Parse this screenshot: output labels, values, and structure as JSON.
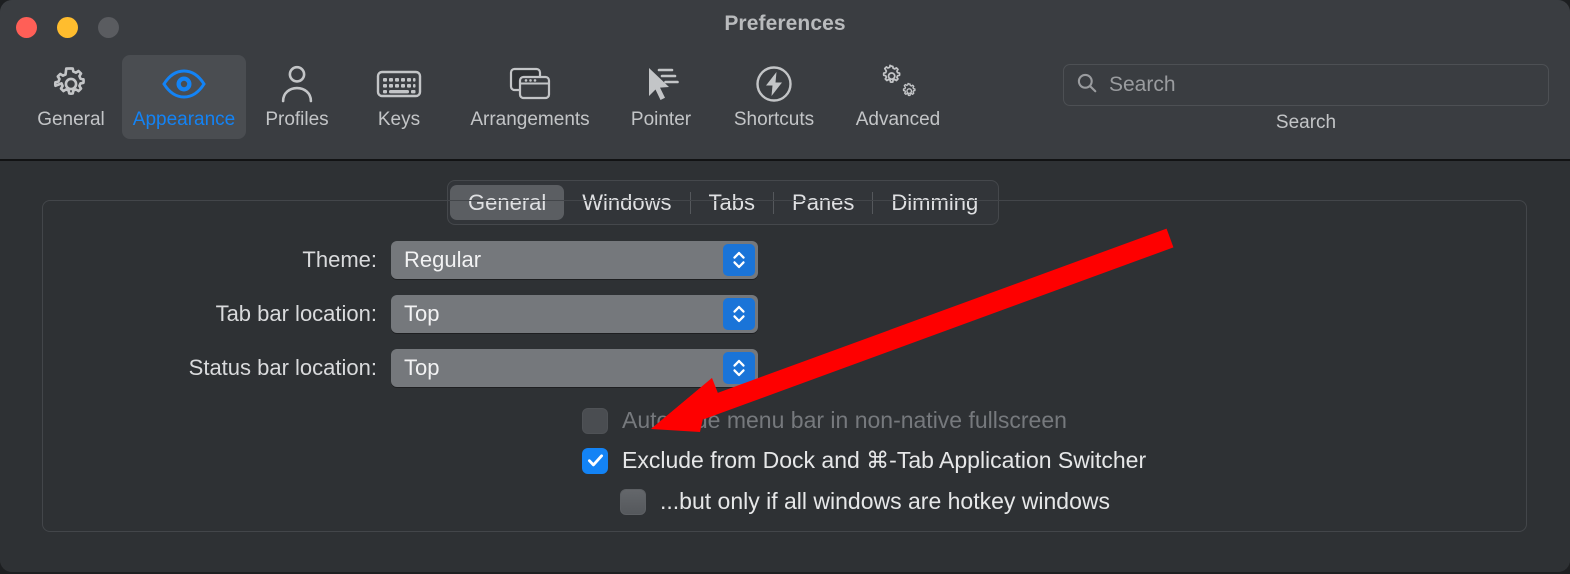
{
  "window": {
    "title": "Preferences",
    "traffic_lights": [
      {
        "name": "close-button",
        "color": "#ff5f57"
      },
      {
        "name": "minimize-button",
        "color": "#ffbd2e"
      },
      {
        "name": "zoom-button",
        "color": "#5a5c60"
      }
    ]
  },
  "toolbar": {
    "items": [
      {
        "label": "General",
        "icon": "gear-icon",
        "selected": false
      },
      {
        "label": "Appearance",
        "icon": "eye-icon",
        "selected": true
      },
      {
        "label": "Profiles",
        "icon": "person-icon",
        "selected": false
      },
      {
        "label": "Keys",
        "icon": "keyboard-icon",
        "selected": false
      },
      {
        "label": "Arrangements",
        "icon": "windows-icon",
        "selected": false
      },
      {
        "label": "Pointer",
        "icon": "cursor-icon",
        "selected": false
      },
      {
        "label": "Shortcuts",
        "icon": "bolt-circle-icon",
        "selected": false
      },
      {
        "label": "Advanced",
        "icon": "gears-icon",
        "selected": false
      }
    ],
    "search": {
      "placeholder": "Search",
      "value": "",
      "caption": "Search",
      "icon": "search-icon"
    }
  },
  "tabs": [
    {
      "label": "General",
      "active": true
    },
    {
      "label": "Windows",
      "active": false
    },
    {
      "label": "Tabs",
      "active": false
    },
    {
      "label": "Panes",
      "active": false
    },
    {
      "label": "Dimming",
      "active": false
    }
  ],
  "form": {
    "rows": [
      {
        "label": "Theme:",
        "value": "Regular"
      },
      {
        "label": "Tab bar location:",
        "value": "Top"
      },
      {
        "label": "Status bar location:",
        "value": "Top"
      }
    ]
  },
  "checkboxes": [
    {
      "label": "Auto-hide menu bar in non-native fullscreen",
      "checked": false,
      "disabled": true
    },
    {
      "label": "Exclude from Dock and ⌘-Tab Application Switcher",
      "checked": true,
      "disabled": false
    },
    {
      "label": "...but only if all windows are hotkey windows",
      "checked": false,
      "disabled": false
    }
  ],
  "annotation": {
    "name": "red-arrow",
    "color": "#fe0000",
    "points_to": "Auto-hide menu bar in non-native fullscreen"
  },
  "colors": {
    "accent": "#1383f5",
    "toolbar_bg": "#3a3d41",
    "window_bg": "#2e3134",
    "text": "#e6e7e8"
  }
}
